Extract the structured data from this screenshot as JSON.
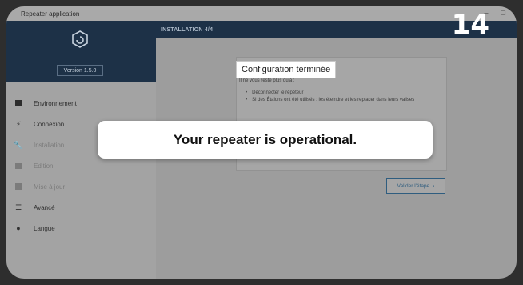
{
  "window": {
    "title": "Repeater application",
    "controls": [
      "–",
      "□"
    ]
  },
  "sidebar": {
    "version": "Version 1.5.0",
    "items": [
      {
        "label": "Environnement",
        "icon": "square-icon",
        "enabled": true
      },
      {
        "label": "Connexion",
        "icon": "lightning-icon",
        "enabled": true
      },
      {
        "label": "Installation",
        "icon": "wrench-icon",
        "enabled": false
      },
      {
        "label": "Edition",
        "icon": "edit-icon",
        "enabled": false
      },
      {
        "label": "Mise à jour",
        "icon": "update-icon",
        "enabled": false
      },
      {
        "label": "Avancé",
        "icon": "sliders-icon",
        "enabled": true
      },
      {
        "label": "Langue",
        "icon": "globe-icon",
        "enabled": true
      }
    ]
  },
  "main": {
    "header": "INSTALLATION 4/4",
    "card_title": "Configuration terminée",
    "card_subtitle": "Il ne vous reste plus qu'à :",
    "instructions": [
      "Déconnecter le répéteur",
      "Si des Étalons ont été utilisés : les éteindre et les replacer dans leurs valises"
    ],
    "next_button": "Valider l'étape"
  },
  "overlay": {
    "callout": "Your repeater is operational.",
    "step_number": "14"
  },
  "colors": {
    "navy": "#1d3147",
    "button_blue": "#2f5d7f"
  }
}
